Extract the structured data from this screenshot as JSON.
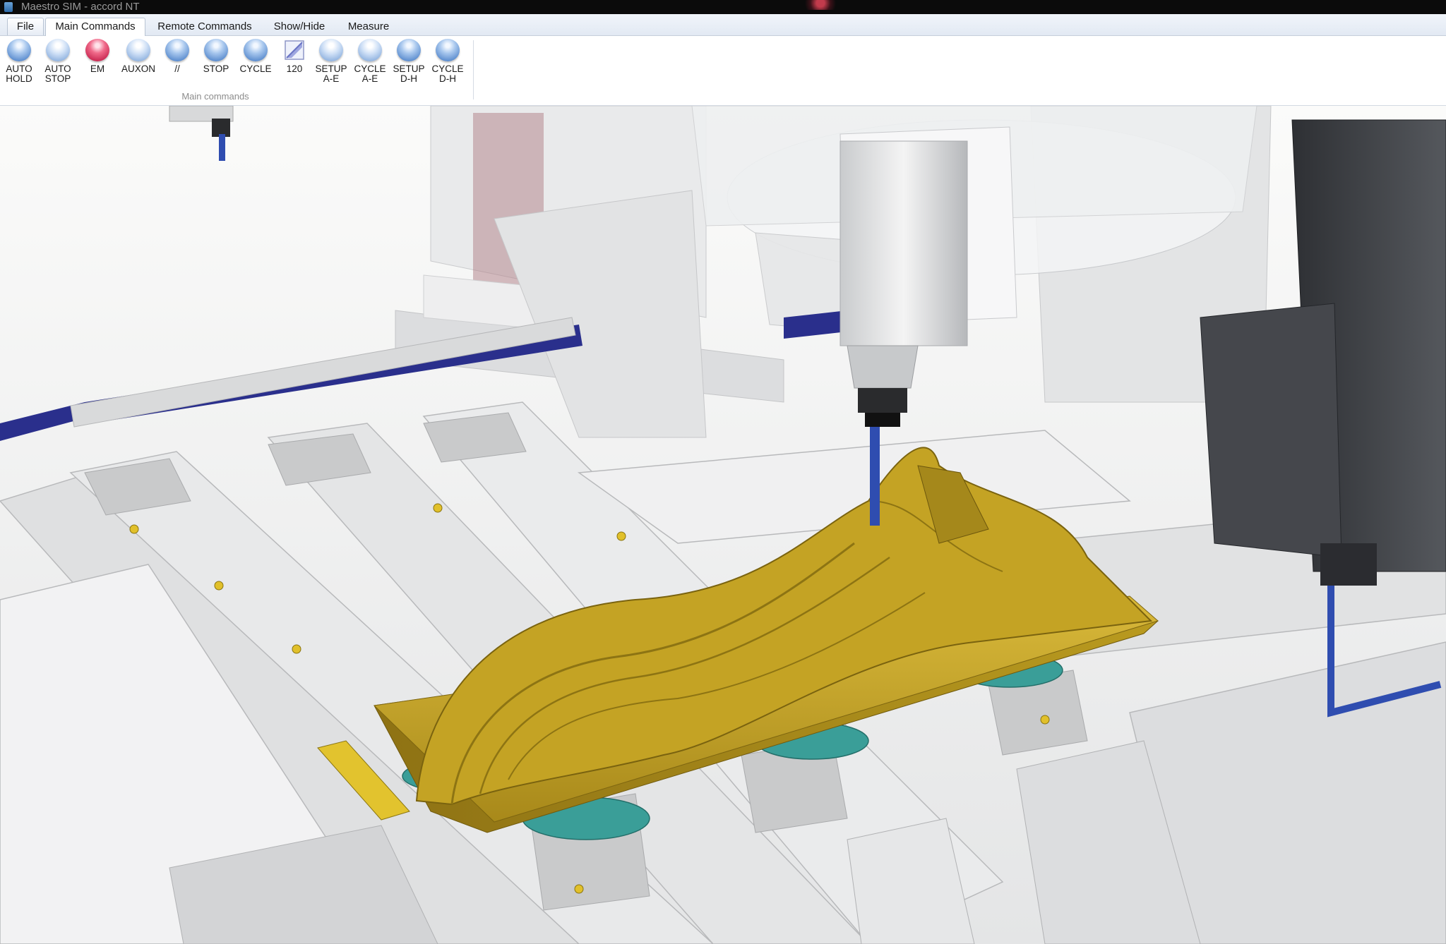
{
  "window": {
    "title": "Maestro SIM - accord NT"
  },
  "tabs": [
    {
      "label": "File"
    },
    {
      "label": "Main Commands"
    },
    {
      "label": "Remote Commands"
    },
    {
      "label": "Show/Hide"
    },
    {
      "label": "Measure"
    }
  ],
  "ribbon": {
    "group_caption": "Main commands",
    "buttons": [
      {
        "label": "AUTO\nHOLD",
        "icon": "blue-orb-icon"
      },
      {
        "label": "AUTO\nSTOP",
        "icon": "light-blue-orb-icon"
      },
      {
        "label": "EM",
        "icon": "red-orb-icon"
      },
      {
        "label": "AUXON",
        "icon": "light-blue-orb-icon"
      },
      {
        "label": "//",
        "icon": "blue-orb-icon"
      },
      {
        "label": "STOP",
        "icon": "blue-orb-icon"
      },
      {
        "label": "CYCLE",
        "icon": "blue-orb-icon"
      },
      {
        "label": "120",
        "icon": "flag-icon"
      },
      {
        "label": "SETUP\nA-E",
        "icon": "light-blue-orb-icon"
      },
      {
        "label": "CYCLE\nA-E",
        "icon": "light-blue-orb-icon"
      },
      {
        "label": "SETUP\nD-H",
        "icon": "blue-orb-icon"
      },
      {
        "label": "CYCLE\nD-H",
        "icon": "blue-orb-icon"
      }
    ]
  },
  "colors": {
    "titlebar": "#0b0b0b",
    "orb_blue": "#4a7fc7",
    "orb_red": "#c01a45",
    "workpiece_gold": "#b99a1f",
    "tool_blue": "#2f4db0",
    "pod_teal": "#3a9e98",
    "machine_gray": "#d6d8da",
    "head_dark": "#3c3e42"
  }
}
